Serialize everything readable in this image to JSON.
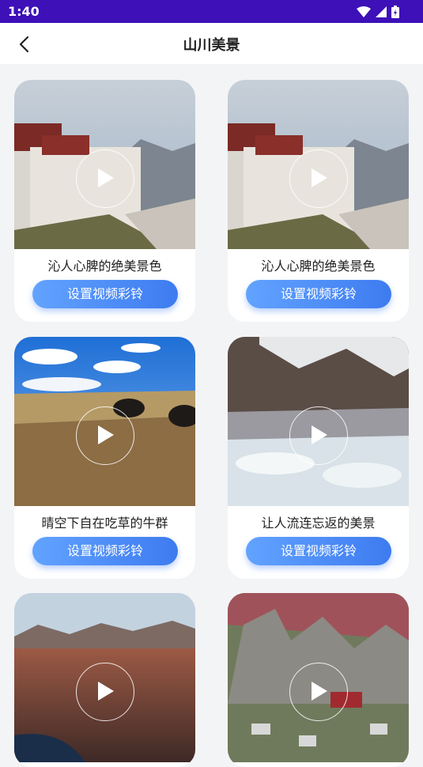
{
  "status_bar": {
    "time": "1:40"
  },
  "header": {
    "title": "山川美景"
  },
  "cards": [
    {
      "caption": "沁人心脾的绝美景色",
      "button": "设置视频彩铃"
    },
    {
      "caption": "沁人心脾的绝美景色",
      "button": "设置视频彩铃"
    },
    {
      "caption": "晴空下自在吃草的牛群",
      "button": "设置视频彩铃"
    },
    {
      "caption": "让人流连忘返的美景",
      "button": "设置视频彩铃"
    },
    {
      "caption": "",
      "button": ""
    },
    {
      "caption": "",
      "button": ""
    }
  ]
}
